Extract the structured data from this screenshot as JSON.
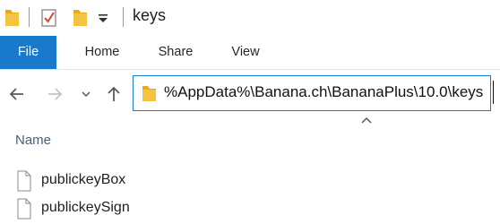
{
  "window": {
    "title": "keys"
  },
  "quick_access": {
    "icons": [
      "folder-icon",
      "properties-check-icon",
      "new-folder-icon",
      "customize-dropdown-icon"
    ]
  },
  "ribbon": {
    "tabs": [
      "File",
      "Home",
      "Share",
      "View"
    ]
  },
  "address_bar": {
    "path": "%AppData%\\Banana.ch\\BananaPlus\\10.0\\keys"
  },
  "file_list": {
    "column_name": "Name",
    "items": [
      {
        "name": "publickeyBox"
      },
      {
        "name": "publickeySign"
      }
    ]
  },
  "colors": {
    "accent": "#1979ca",
    "folder": "#f5c242",
    "header_text": "#4c607a"
  }
}
